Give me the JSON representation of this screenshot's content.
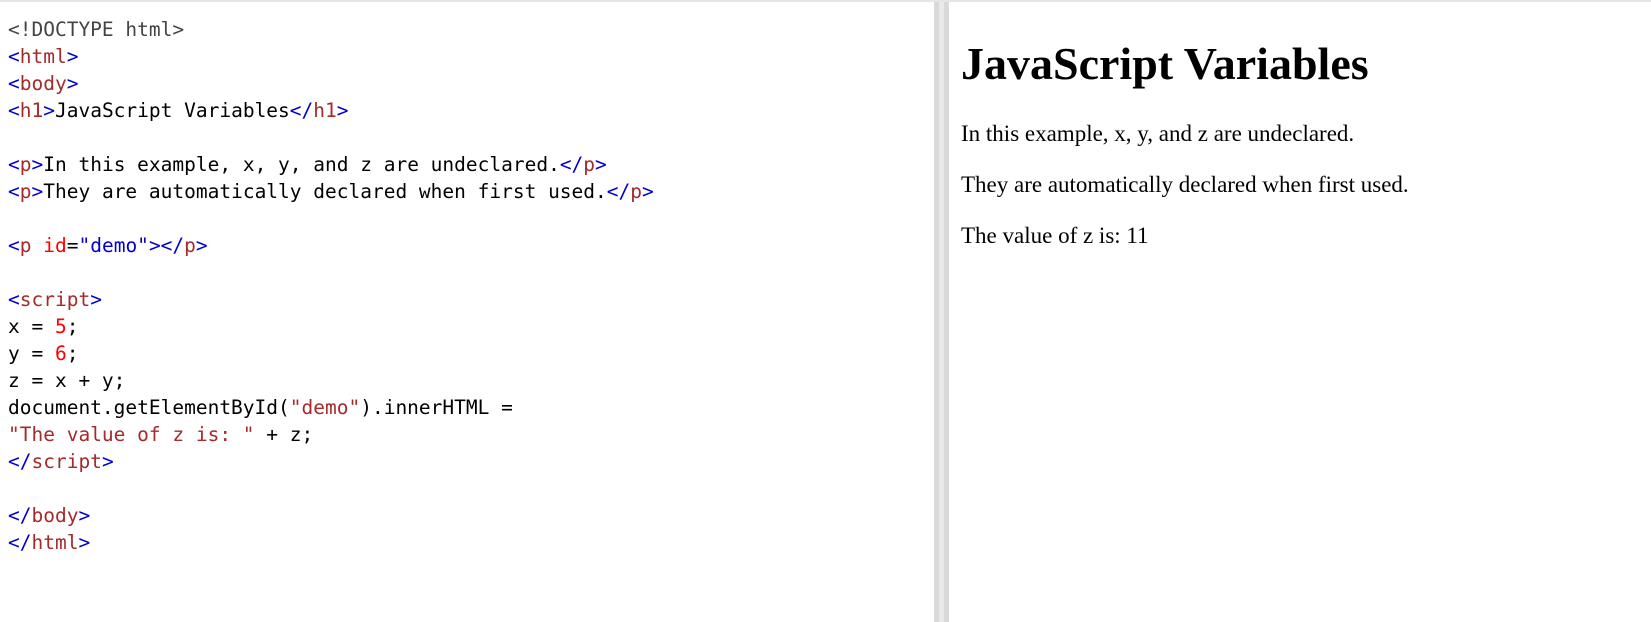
{
  "editor": {
    "lines": [
      {
        "tokens": [
          {
            "t": "doctype",
            "v": "<!DOCTYPE html>"
          }
        ]
      },
      {
        "tokens": [
          {
            "t": "bracket",
            "v": "<"
          },
          {
            "t": "tag",
            "v": "html"
          },
          {
            "t": "bracket",
            "v": ">"
          }
        ]
      },
      {
        "tokens": [
          {
            "t": "bracket",
            "v": "<"
          },
          {
            "t": "tag",
            "v": "body"
          },
          {
            "t": "bracket",
            "v": ">"
          }
        ]
      },
      {
        "tokens": [
          {
            "t": "bracket",
            "v": "<"
          },
          {
            "t": "tag",
            "v": "h1"
          },
          {
            "t": "bracket",
            "v": ">"
          },
          {
            "t": "plain",
            "v": "JavaScript Variables"
          },
          {
            "t": "bracket",
            "v": "</"
          },
          {
            "t": "tag",
            "v": "h1"
          },
          {
            "t": "bracket",
            "v": ">"
          }
        ]
      },
      {
        "tokens": []
      },
      {
        "tokens": [
          {
            "t": "bracket",
            "v": "<"
          },
          {
            "t": "tag",
            "v": "p"
          },
          {
            "t": "bracket",
            "v": ">"
          },
          {
            "t": "plain",
            "v": "In this example, x, y, and z are undeclared."
          },
          {
            "t": "bracket",
            "v": "</"
          },
          {
            "t": "tag",
            "v": "p"
          },
          {
            "t": "bracket",
            "v": ">"
          }
        ]
      },
      {
        "tokens": [
          {
            "t": "bracket",
            "v": "<"
          },
          {
            "t": "tag",
            "v": "p"
          },
          {
            "t": "bracket",
            "v": ">"
          },
          {
            "t": "plain",
            "v": "They are automatically declared when first used."
          },
          {
            "t": "bracket",
            "v": "</"
          },
          {
            "t": "tag",
            "v": "p"
          },
          {
            "t": "bracket",
            "v": ">"
          }
        ]
      },
      {
        "tokens": []
      },
      {
        "tokens": [
          {
            "t": "bracket",
            "v": "<"
          },
          {
            "t": "tag",
            "v": "p"
          },
          {
            "t": "plain",
            "v": " "
          },
          {
            "t": "attr",
            "v": "id"
          },
          {
            "t": "plain",
            "v": "="
          },
          {
            "t": "attrval",
            "v": "\"demo\""
          },
          {
            "t": "bracket",
            "v": "></"
          },
          {
            "t": "tag",
            "v": "p"
          },
          {
            "t": "bracket",
            "v": ">"
          }
        ]
      },
      {
        "tokens": []
      },
      {
        "tokens": [
          {
            "t": "bracket",
            "v": "<"
          },
          {
            "t": "tag",
            "v": "script"
          },
          {
            "t": "bracket",
            "v": ">"
          }
        ]
      },
      {
        "tokens": [
          {
            "t": "plain",
            "v": "x = "
          },
          {
            "t": "number",
            "v": "5"
          },
          {
            "t": "plain",
            "v": ";"
          }
        ]
      },
      {
        "tokens": [
          {
            "t": "plain",
            "v": "y = "
          },
          {
            "t": "number",
            "v": "6"
          },
          {
            "t": "plain",
            "v": ";"
          }
        ]
      },
      {
        "tokens": [
          {
            "t": "plain",
            "v": "z = x + y;"
          }
        ]
      },
      {
        "tokens": [
          {
            "t": "plain",
            "v": "document.getElementById("
          },
          {
            "t": "string",
            "v": "\"demo\""
          },
          {
            "t": "plain",
            "v": ").innerHTML ="
          }
        ]
      },
      {
        "tokens": [
          {
            "t": "string",
            "v": "\"The value of z is: \""
          },
          {
            "t": "plain",
            "v": " + z;"
          }
        ]
      },
      {
        "tokens": [
          {
            "t": "bracket",
            "v": "</"
          },
          {
            "t": "tag",
            "v": "script"
          },
          {
            "t": "bracket",
            "v": ">"
          }
        ]
      },
      {
        "tokens": []
      },
      {
        "tokens": [
          {
            "t": "bracket",
            "v": "</"
          },
          {
            "t": "tag",
            "v": "body"
          },
          {
            "t": "bracket",
            "v": ">"
          }
        ]
      },
      {
        "tokens": [
          {
            "t": "bracket",
            "v": "</"
          },
          {
            "t": "tag",
            "v": "html"
          },
          {
            "t": "bracket",
            "v": ">"
          }
        ]
      }
    ]
  },
  "result": {
    "heading": "JavaScript Variables",
    "paragraphs": [
      "In this example, x, y, and z are undeclared.",
      "They are automatically declared when first used.",
      "The value of z is: 11"
    ]
  },
  "colors": {
    "bracket": "#0000cd",
    "tag": "#a52a2a",
    "attr": "#ff0000",
    "attrval": "#0000cd",
    "number": "#ff0000",
    "string": "#a52a2a",
    "plain": "#000000",
    "doctype": "#444444",
    "splitter": "#d9d9d9"
  }
}
